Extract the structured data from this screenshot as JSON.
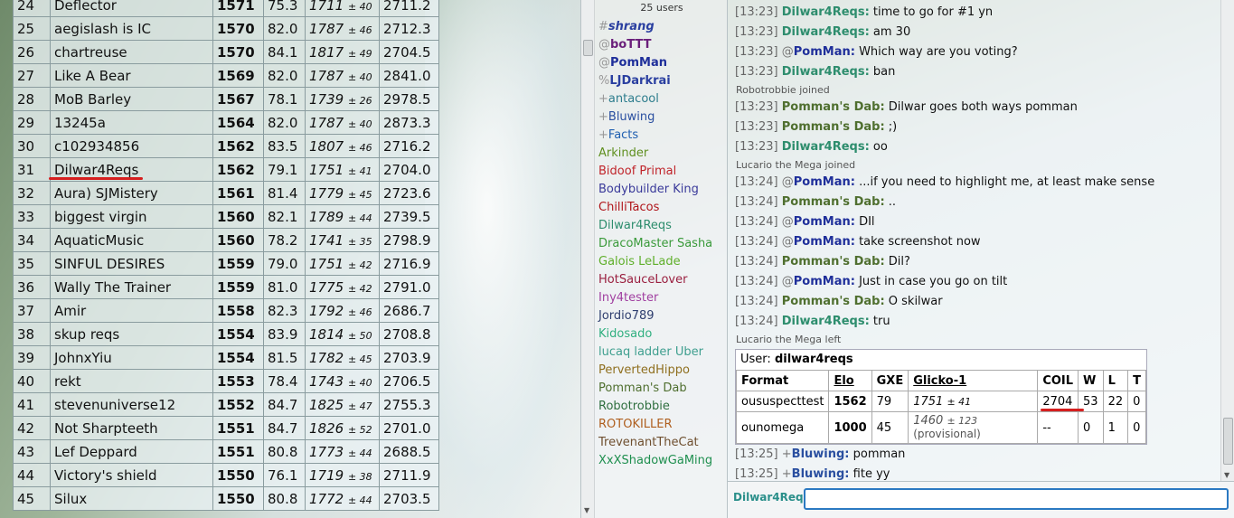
{
  "ladder": {
    "rows": [
      {
        "rank": "24",
        "name": "Deflector",
        "elo": "1571",
        "gxe": "75.3",
        "glicko": "1711",
        "dev": "± 40",
        "coil": "2711.2"
      },
      {
        "rank": "25",
        "name": "aegislash is IC",
        "elo": "1570",
        "gxe": "82.0",
        "glicko": "1787",
        "dev": "± 46",
        "coil": "2712.3"
      },
      {
        "rank": "26",
        "name": "chartreuse",
        "elo": "1570",
        "gxe": "84.1",
        "glicko": "1817",
        "dev": "± 49",
        "coil": "2704.5"
      },
      {
        "rank": "27",
        "name": "Like A Bear",
        "elo": "1569",
        "gxe": "82.0",
        "glicko": "1787",
        "dev": "± 40",
        "coil": "2841.0"
      },
      {
        "rank": "28",
        "name": "MoB Barley",
        "elo": "1567",
        "gxe": "78.1",
        "glicko": "1739",
        "dev": "± 26",
        "coil": "2978.5"
      },
      {
        "rank": "29",
        "name": "13245a",
        "elo": "1564",
        "gxe": "82.0",
        "glicko": "1787",
        "dev": "± 40",
        "coil": "2873.3"
      },
      {
        "rank": "30",
        "name": "c102934856",
        "elo": "1562",
        "gxe": "83.5",
        "glicko": "1807",
        "dev": "± 46",
        "coil": "2716.2"
      },
      {
        "rank": "31",
        "name": "Dilwar4Reqs",
        "elo": "1562",
        "gxe": "79.1",
        "glicko": "1751",
        "dev": "± 41",
        "coil": "2704.0"
      },
      {
        "rank": "32",
        "name": "Aura) SJMistery",
        "elo": "1561",
        "gxe": "81.4",
        "glicko": "1779",
        "dev": "± 45",
        "coil": "2723.6"
      },
      {
        "rank": "33",
        "name": "biggest virgin",
        "elo": "1560",
        "gxe": "82.1",
        "glicko": "1789",
        "dev": "± 44",
        "coil": "2739.5"
      },
      {
        "rank": "34",
        "name": "AquaticMusic",
        "elo": "1560",
        "gxe": "78.2",
        "glicko": "1741",
        "dev": "± 35",
        "coil": "2798.9"
      },
      {
        "rank": "35",
        "name": "SINFUL DESIRES",
        "elo": "1559",
        "gxe": "79.0",
        "glicko": "1751",
        "dev": "± 42",
        "coil": "2716.9"
      },
      {
        "rank": "36",
        "name": "Wally The Trainer",
        "elo": "1559",
        "gxe": "81.0",
        "glicko": "1775",
        "dev": "± 42",
        "coil": "2791.0"
      },
      {
        "rank": "37",
        "name": "Amir",
        "elo": "1558",
        "gxe": "82.3",
        "glicko": "1792",
        "dev": "± 46",
        "coil": "2686.7"
      },
      {
        "rank": "38",
        "name": "skup reqs",
        "elo": "1554",
        "gxe": "83.9",
        "glicko": "1814",
        "dev": "± 50",
        "coil": "2708.8"
      },
      {
        "rank": "39",
        "name": "JohnxYiu",
        "elo": "1554",
        "gxe": "81.5",
        "glicko": "1782",
        "dev": "± 45",
        "coil": "2703.9"
      },
      {
        "rank": "40",
        "name": "rekt",
        "elo": "1553",
        "gxe": "78.4",
        "glicko": "1743",
        "dev": "± 40",
        "coil": "2706.5"
      },
      {
        "rank": "41",
        "name": "stevenuniverse12",
        "elo": "1552",
        "gxe": "84.7",
        "glicko": "1825",
        "dev": "± 47",
        "coil": "2755.3"
      },
      {
        "rank": "42",
        "name": "Not Sharpteeth",
        "elo": "1551",
        "gxe": "84.7",
        "glicko": "1826",
        "dev": "± 52",
        "coil": "2701.0"
      },
      {
        "rank": "43",
        "name": "Lef Deppard",
        "elo": "1551",
        "gxe": "80.8",
        "glicko": "1773",
        "dev": "± 44",
        "coil": "2688.5"
      },
      {
        "rank": "44",
        "name": "Victory's shield",
        "elo": "1550",
        "gxe": "76.1",
        "glicko": "1719",
        "dev": "± 38",
        "coil": "2711.9"
      },
      {
        "rank": "45",
        "name": "Silux",
        "elo": "1550",
        "gxe": "80.8",
        "glicko": "1772",
        "dev": "± 44",
        "coil": "2703.5"
      }
    ]
  },
  "userlist": {
    "count": "25 users",
    "users": [
      {
        "sym": "#",
        "name": "shrang",
        "color": "#2a3fa0",
        "style": "bi"
      },
      {
        "sym": "@",
        "name": "boTTT",
        "color": "#6a1f7a",
        "style": "b"
      },
      {
        "sym": "@",
        "name": "PomMan",
        "color": "#1f2f9a",
        "style": "b"
      },
      {
        "sym": "%",
        "name": "LJDarkrai",
        "color": "#2a3fa0",
        "style": "b"
      },
      {
        "sym": "+",
        "name": "antacool",
        "color": "#2d7d8d",
        "style": ""
      },
      {
        "sym": "+",
        "name": "Bluwing",
        "color": "#2a4fa0",
        "style": ""
      },
      {
        "sym": "+",
        "name": "Facts",
        "color": "#1f5fb0",
        "style": ""
      },
      {
        "sym": "",
        "name": "Arkinder",
        "color": "#5f8f1f",
        "style": ""
      },
      {
        "sym": "",
        "name": "Bidoof Primal",
        "color": "#c0242a",
        "style": ""
      },
      {
        "sym": "",
        "name": "Bodybuilder King",
        "color": "#3a3a9a",
        "style": ""
      },
      {
        "sym": "",
        "name": "ChilliTacos",
        "color": "#b0151a",
        "style": ""
      },
      {
        "sym": "",
        "name": "Dilwar4Reqs",
        "color": "#2d8d6d",
        "style": ""
      },
      {
        "sym": "",
        "name": "DracoMaster Sasha",
        "color": "#3a9a3a",
        "style": ""
      },
      {
        "sym": "",
        "name": "Galois LeLade",
        "color": "#5faf2a",
        "style": ""
      },
      {
        "sym": "",
        "name": "HotSauceLover",
        "color": "#9a1f3f",
        "style": ""
      },
      {
        "sym": "",
        "name": "Iny4tester",
        "color": "#a03fa0",
        "style": ""
      },
      {
        "sym": "",
        "name": "Jordio789",
        "color": "#2f3f6f",
        "style": ""
      },
      {
        "sym": "",
        "name": "Kidosado",
        "color": "#2faf7f",
        "style": ""
      },
      {
        "sym": "",
        "name": "lucaq ladder Uber",
        "color": "#3f9f8f",
        "style": ""
      },
      {
        "sym": "",
        "name": "PervertedHippo",
        "color": "#8f6f1f",
        "style": ""
      },
      {
        "sym": "",
        "name": "Pomman's Dab",
        "color": "#4f6f2f",
        "style": ""
      },
      {
        "sym": "",
        "name": "Robotrobbie",
        "color": "#2f6f3f",
        "style": ""
      },
      {
        "sym": "",
        "name": "ROTOKILLER",
        "color": "#af5f1f",
        "style": ""
      },
      {
        "sym": "",
        "name": "TrevenantTheCat",
        "color": "#6f4f2f",
        "style": ""
      },
      {
        "sym": "",
        "name": "XxXShadowGaMing",
        "color": "#1f8f4f",
        "style": ""
      }
    ]
  },
  "chat": {
    "entries": [
      {
        "type": "msg",
        "ts": "[13:23]",
        "rank": "",
        "user": "Dilwar4Reqs:",
        "color": "#2d8d6d",
        "text": "time to go for #1 yn"
      },
      {
        "type": "msg",
        "ts": "[13:23]",
        "rank": "",
        "user": "Dilwar4Reqs:",
        "color": "#2d8d6d",
        "text": "am 30"
      },
      {
        "type": "msg",
        "ts": "[13:23]",
        "rank": "@",
        "user": "PomMan:",
        "color": "#1f2f9a",
        "text": "Which way are you voting?"
      },
      {
        "type": "msg",
        "ts": "[13:23]",
        "rank": "",
        "user": "Dilwar4Reqs:",
        "color": "#2d8d6d",
        "text": "ban"
      },
      {
        "type": "notice",
        "text": "Robotrobbie joined"
      },
      {
        "type": "msg",
        "ts": "[13:23]",
        "rank": "",
        "user": "Pomman's Dab:",
        "color": "#4f6f2f",
        "text": "Dilwar goes both ways pomman"
      },
      {
        "type": "msg",
        "ts": "[13:23]",
        "rank": "",
        "user": "Pomman's Dab:",
        "color": "#4f6f2f",
        "text": ";)"
      },
      {
        "type": "msg",
        "ts": "[13:23]",
        "rank": "",
        "user": "Dilwar4Reqs:",
        "color": "#2d8d6d",
        "text": "oo"
      },
      {
        "type": "notice",
        "text": "Lucario the Mega joined"
      },
      {
        "type": "msg",
        "ts": "[13:24]",
        "rank": "@",
        "user": "PomMan:",
        "color": "#1f2f9a",
        "text": "...if you need to highlight me, at least make sense"
      },
      {
        "type": "msg",
        "ts": "[13:24]",
        "rank": "",
        "user": "Pomman's Dab:",
        "color": "#4f6f2f",
        "text": ".."
      },
      {
        "type": "msg",
        "ts": "[13:24]",
        "rank": "@",
        "user": "PomMan:",
        "color": "#1f2f9a",
        "text": "DIl"
      },
      {
        "type": "msg",
        "ts": "[13:24]",
        "rank": "@",
        "user": "PomMan:",
        "color": "#1f2f9a",
        "text": "take screenshot now"
      },
      {
        "type": "msg",
        "ts": "[13:24]",
        "rank": "",
        "user": "Pomman's Dab:",
        "color": "#4f6f2f",
        "text": "Dil?"
      },
      {
        "type": "msg",
        "ts": "[13:24]",
        "rank": "@",
        "user": "PomMan:",
        "color": "#1f2f9a",
        "text": "Just in case you go on tilt"
      },
      {
        "type": "msg",
        "ts": "[13:24]",
        "rank": "",
        "user": "Pomman's Dab:",
        "color": "#4f6f2f",
        "text": "O skilwar"
      },
      {
        "type": "msg",
        "ts": "[13:24]",
        "rank": "",
        "user": "Dilwar4Reqs:",
        "color": "#2d8d6d",
        "text": "tru"
      },
      {
        "type": "notice",
        "text": "Lucario the Mega left"
      }
    ],
    "rank_popup": {
      "user_label": "User:",
      "user": "dilwar4reqs",
      "headers": [
        "Format",
        "Elo",
        "GXE",
        "Glicko-1",
        "COIL",
        "W",
        "L",
        "T"
      ],
      "rows": [
        {
          "format": "oususpecttest",
          "elo": "1562",
          "gxe": "79",
          "glicko": "1751",
          "dev": "± 41",
          "prov": "",
          "coil": "2704",
          "w": "53",
          "l": "22",
          "t": "0"
        },
        {
          "format": "ounomega",
          "elo": "1000",
          "gxe": "45",
          "glicko": "1460",
          "dev": "± 123",
          "prov": "(provisional)",
          "coil": "--",
          "w": "0",
          "l": "1",
          "t": "0"
        }
      ]
    },
    "after": [
      {
        "type": "msg",
        "ts": "[13:25]",
        "rank": "+",
        "user": "Bluwing:",
        "color": "#2a4fa0",
        "text": "pomman"
      },
      {
        "type": "msg",
        "ts": "[13:25]",
        "rank": "+",
        "user": "Bluwing:",
        "color": "#2a4fa0",
        "text": "fite yy"
      }
    ],
    "self_name": "Dilwar4Req",
    "input_value": ""
  },
  "colors": {
    "highlight_underline": "#d61f1f",
    "input_border": "#2b79c2"
  }
}
